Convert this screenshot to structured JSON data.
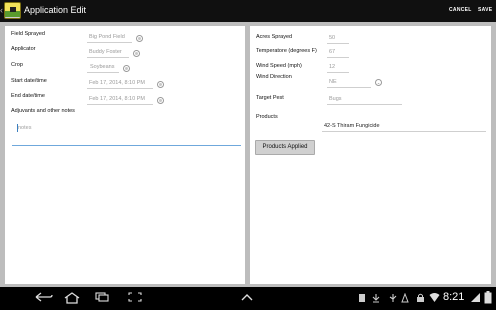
{
  "app": {
    "title": "Application Edit",
    "icon": "app-logo-icon"
  },
  "actions": {
    "cancel_label": "CANCEL",
    "save_label": "SAVE"
  },
  "left": {
    "field_sprayed": {
      "label": "Field Sprayed",
      "value": "Big Pond Field"
    },
    "applicator": {
      "label": "Applicator",
      "value": "Buddy Foster"
    },
    "crop": {
      "label": "Crop",
      "value": "Soybeans"
    },
    "start": {
      "label": "Start date/time",
      "value": "Feb 17, 2014, 8:10 PM"
    },
    "end": {
      "label": "End date/time",
      "value": "Feb 17, 2014, 8:10 PM"
    },
    "adjuvants": {
      "label": "Adjuvants and other notes"
    },
    "notes": {
      "placeholder": "notes"
    }
  },
  "right": {
    "acres": {
      "label": "Acres Sprayed",
      "value": "50"
    },
    "temperature": {
      "label": "Temperatore (degrees F)",
      "value": "67"
    },
    "wind_speed": {
      "label": "Wind Speed (mph)",
      "value": "12"
    },
    "wind_direction": {
      "label": "Wind Direction",
      "value": "NE"
    },
    "target_pest": {
      "label": "Target Pest",
      "value": "Bugs"
    },
    "products": {
      "label": "Products",
      "items": [
        "42-S Thiram Fungicide"
      ]
    },
    "products_button": "Products Applied"
  },
  "status": {
    "time": "8:21"
  },
  "colors": {
    "actionbar": "#101010",
    "background": "#bdbdbd",
    "panel": "#ffffff",
    "focus_underline": "#6fa8dc"
  }
}
